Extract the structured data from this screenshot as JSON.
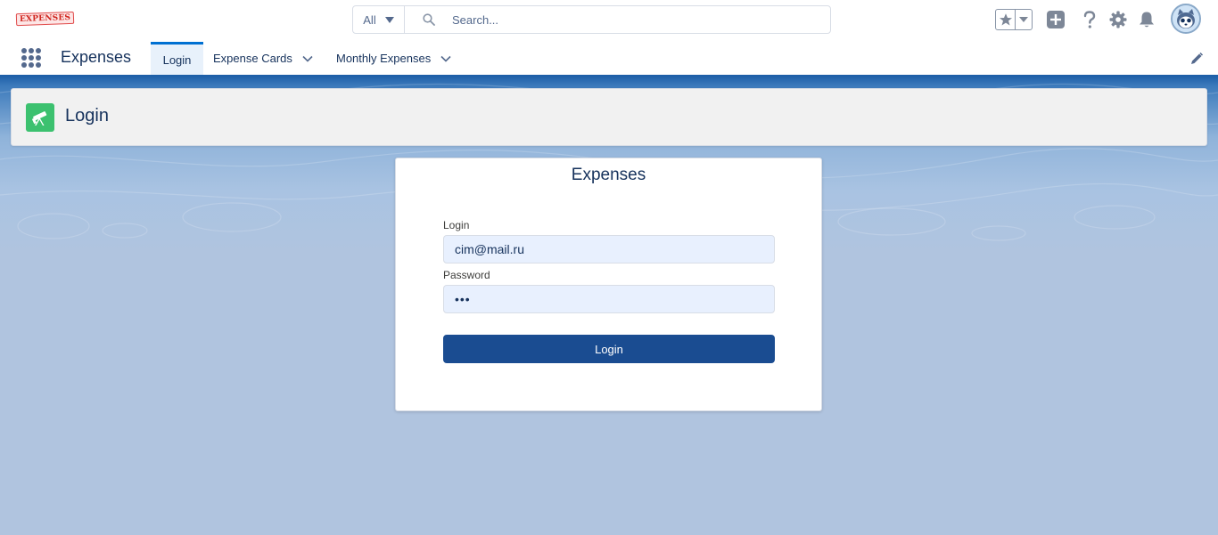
{
  "header": {
    "logo_text": "EXPENSES",
    "search_scope": "All",
    "search_placeholder": "Search..."
  },
  "nav": {
    "app_name": "Expenses",
    "tabs": [
      {
        "label": "Login",
        "active": true
      },
      {
        "label": "Expense Cards",
        "has_menu": true
      },
      {
        "label": "Monthly Expenses",
        "has_menu": true
      }
    ]
  },
  "page_header": {
    "title": "Login",
    "icon": "telescope-icon",
    "icon_color": "#3cc16f"
  },
  "login_card": {
    "title": "Expenses",
    "login_label": "Login",
    "login_value": "cim@mail.ru",
    "password_label": "Password",
    "password_value": "•••",
    "submit_label": "Login",
    "button_color": "#1a4c91"
  },
  "colors": {
    "accent": "#0070d2",
    "background": "#b0c4df"
  }
}
